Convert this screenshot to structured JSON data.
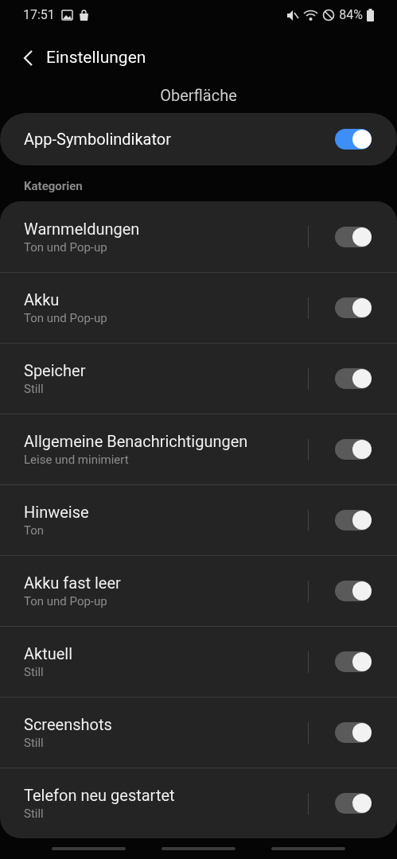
{
  "status_bar": {
    "time": "17:51",
    "battery": "84%"
  },
  "header": {
    "back_label": "Einstellungen",
    "page_title": "Oberfläche"
  },
  "main_toggle": {
    "label": "App-Symbolindikator",
    "on": true,
    "disabled": false
  },
  "section_label": "Kategorien",
  "categories": [
    {
      "title": "Warnmeldungen",
      "subtitle": "Ton und Pop-up",
      "on": true,
      "disabled": true
    },
    {
      "title": "Akku",
      "subtitle": "Ton und Pop-up",
      "on": true,
      "disabled": true
    },
    {
      "title": "Speicher",
      "subtitle": "Still",
      "on": true,
      "disabled": true
    },
    {
      "title": "Allgemeine Benachrichtigungen",
      "subtitle": "Leise und minimiert",
      "on": true,
      "disabled": true
    },
    {
      "title": "Hinweise",
      "subtitle": "Ton",
      "on": true,
      "disabled": true
    },
    {
      "title": "Akku fast leer",
      "subtitle": "Ton und Pop-up",
      "on": true,
      "disabled": true
    },
    {
      "title": "Aktuell",
      "subtitle": "Still",
      "on": true,
      "disabled": true
    },
    {
      "title": "Screenshots",
      "subtitle": "Still",
      "on": true,
      "disabled": true
    },
    {
      "title": "Telefon neu gestartet",
      "subtitle": "Still",
      "on": true,
      "disabled": true
    }
  ]
}
